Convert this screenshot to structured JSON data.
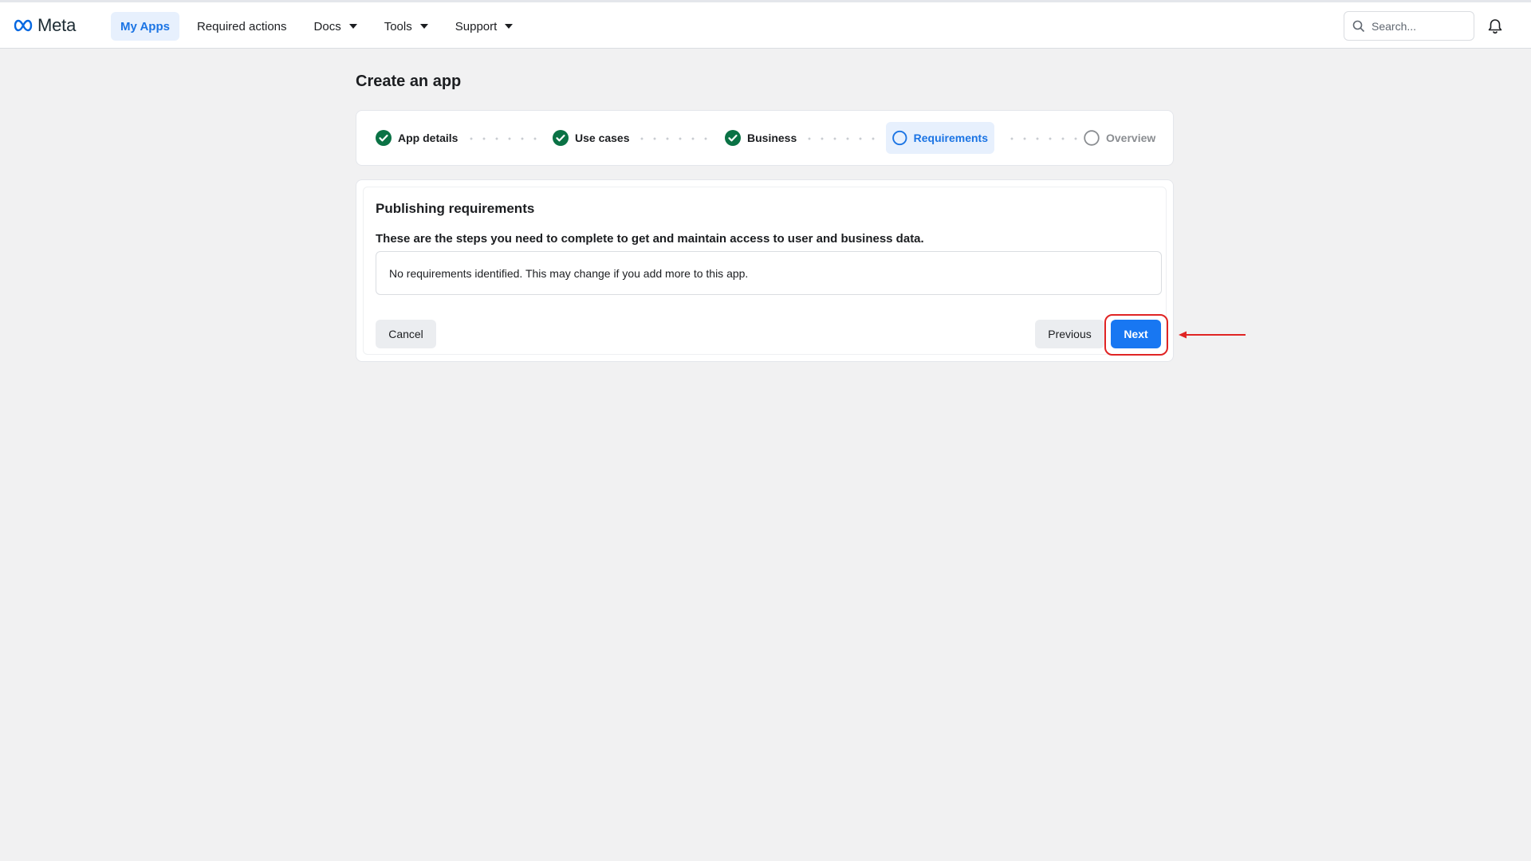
{
  "topbar": {
    "logo_text": "Meta",
    "nav": [
      {
        "label": "My Apps",
        "active": true
      },
      {
        "label": "Required actions"
      },
      {
        "label": "Docs",
        "dropdown": true
      },
      {
        "label": "Tools",
        "dropdown": true
      },
      {
        "label": "Support",
        "dropdown": true
      }
    ],
    "search_placeholder": "Search...",
    "icons": {
      "search": "search-icon",
      "bell": "bell-icon"
    }
  },
  "page": {
    "title": "Create an app"
  },
  "stepper": {
    "steps": [
      {
        "label": "App details",
        "state": "done"
      },
      {
        "label": "Use cases",
        "state": "done"
      },
      {
        "label": "Business",
        "state": "done"
      },
      {
        "label": "Requirements",
        "state": "current"
      },
      {
        "label": "Overview",
        "state": "todo"
      }
    ]
  },
  "card": {
    "title": "Publishing requirements",
    "subtitle": "These are the steps you need to complete to get and maintain access to user and business data.",
    "requirements_text": "No requirements identified. This may change if you add more to this app.",
    "cancel_label": "Cancel",
    "previous_label": "Previous",
    "next_label": "Next"
  },
  "colors": {
    "accent": "#1877f2",
    "done_green": "#0a7245",
    "annotation_red": "#e02424"
  }
}
